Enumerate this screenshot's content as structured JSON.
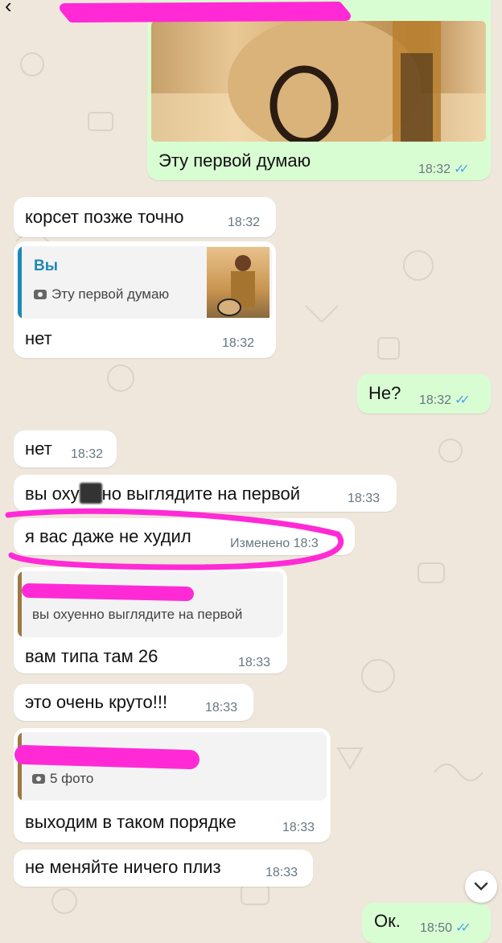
{
  "header": {
    "back_glyph": "‹"
  },
  "messages": [
    {
      "id": 1,
      "text": "Эту первой думаю",
      "time": "18:32",
      "ticks": "✓✓"
    },
    {
      "id": 2,
      "text": "корсет позже точно",
      "time": "18:32"
    },
    {
      "id": 3,
      "quote_name": "Вы",
      "quote_text": "Эту первой думаю",
      "text": "нет",
      "time": "18:32"
    },
    {
      "id": 4,
      "text": "Не?",
      "time": "18:32",
      "ticks": "✓✓"
    },
    {
      "id": 5,
      "text": "нет",
      "time": "18:32"
    },
    {
      "id": 6,
      "text_before": "вы оху",
      "text_after": "но выглядите на первой",
      "time": "18:33"
    },
    {
      "id": 7,
      "text": "я вас даже не худил",
      "edited": "Изменено 18:3"
    },
    {
      "id": 8,
      "quote_text": "вы охуенно выглядите на первой",
      "text": "вам типа там 26",
      "time": "18:33"
    },
    {
      "id": 9,
      "text": "это очень круто!!!",
      "time": "18:33"
    },
    {
      "id": 10,
      "quote_text": "5 фото",
      "text": "выходим в таком порядке",
      "time": "18:33"
    },
    {
      "id": 11,
      "text": "не меняйте ничего плиз",
      "time": "18:33"
    },
    {
      "id": 12,
      "text": "Ок.",
      "time": "18:50",
      "ticks": "✓✓"
    }
  ],
  "colors": {
    "background": "#efe7dc",
    "incoming": "#ffffff",
    "outgoing": "#d9fdd3",
    "read_ticks": "#4fa3e8",
    "highlight": "#ff2ad6",
    "quote_bar_self": "#1e88b6",
    "quote_bar_other": "#9d7a43"
  },
  "icons": [
    "back-icon",
    "camera-icon",
    "double-check-icon",
    "chevron-down-icon"
  ]
}
